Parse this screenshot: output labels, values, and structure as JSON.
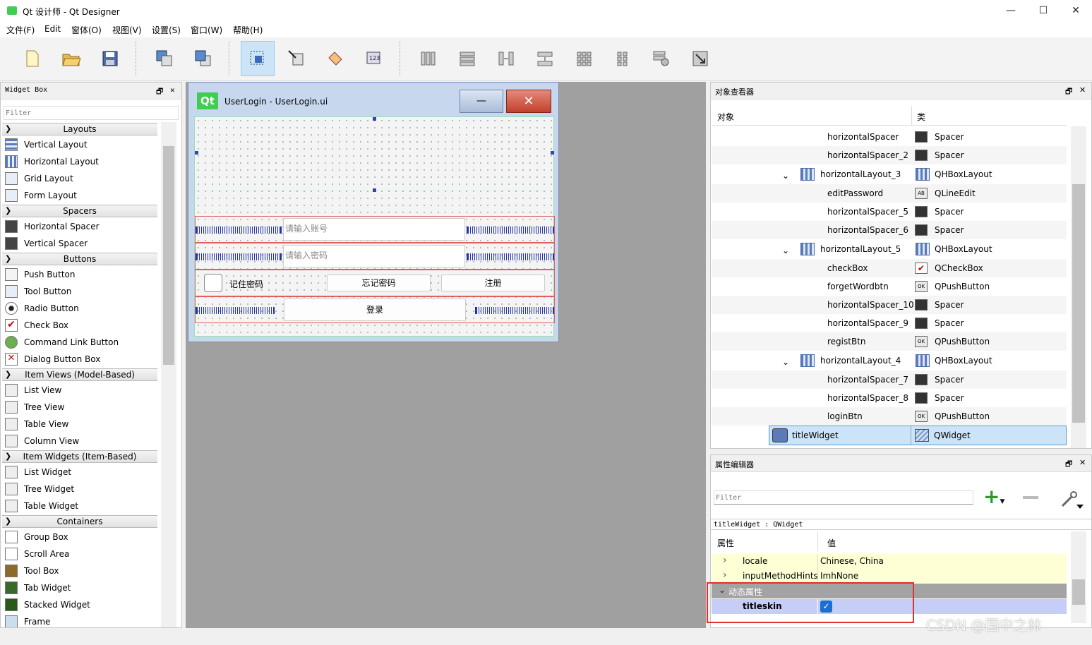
{
  "window": {
    "title": "Qt 设计师 - Qt Designer",
    "min": "—",
    "max": "☐",
    "close": "✕"
  },
  "menubar": [
    "文件(F)",
    "Edit",
    "窗体(O)",
    "视图(V)",
    "设置(S)",
    "窗口(W)",
    "帮助(H)"
  ],
  "toolbar": {
    "icons": [
      "new-file-icon",
      "open-folder-icon",
      "save-icon",
      "send-backward-icon",
      "bring-forward-icon",
      "edit-widgets-icon",
      "edit-signals-slots-icon",
      "edit-buddies-icon",
      "edit-tab-order-icon",
      "layout-horizontal-icon",
      "layout-vertical-icon",
      "layout-h-splitter-icon",
      "layout-v-splitter-icon",
      "layout-grid-icon",
      "layout-form-icon",
      "break-layout-icon",
      "adjust-size-icon"
    ]
  },
  "widget_box": {
    "title": "Widget Box",
    "float": "🗗",
    "close": "✕",
    "filter_placeholder": "Filter",
    "layouts": "Layouts",
    "vertical_layout": "Vertical Layout",
    "horizontal_layout": "Horizontal Layout",
    "grid_layout": "Grid Layout",
    "form_layout": "Form Layout",
    "spacers": "Spacers",
    "horizontal_spacer": "Horizontal Spacer",
    "vertical_spacer": "Vertical Spacer",
    "buttons": "Buttons",
    "push_button": "Push Button",
    "tool_button": "Tool Button",
    "radio_button": "Radio Button",
    "check_box": "Check Box",
    "command_link_button": "Command Link Button",
    "dialog_button_box": "Dialog Button Box",
    "item_views": "Item Views (Model-Based)",
    "list_view": "List View",
    "tree_view": "Tree View",
    "table_view": "Table View",
    "column_view": "Column View",
    "item_widgets": "Item Widgets (Item-Based)",
    "list_widget": "List Widget",
    "tree_widget": "Tree Widget",
    "table_widget": "Table Widget",
    "containers": "Containers",
    "group_box": "Group Box",
    "scroll_area": "Scroll Area",
    "tool_box": "Tool Box",
    "tab_widget": "Tab Widget",
    "stacked_widget": "Stacked Widget",
    "frame": "Frame"
  },
  "form": {
    "logo": "Qt",
    "title": "UserLogin - UserLogin.ui",
    "min": "—",
    "close": "✕",
    "account_placeholder": "请输入账号",
    "password_placeholder": "请输入密码",
    "remember": "记住密码",
    "forget": "忘记密码",
    "register": "注册",
    "login": "登录"
  },
  "object_inspector": {
    "title": "对象查看器",
    "float": "🗗",
    "close": "✕",
    "col_object": "对象",
    "col_class": "类",
    "rows": [
      {
        "name": "horizontalSpacer",
        "cls": "Spacer"
      },
      {
        "name": "horizontalSpacer_2",
        "cls": "Spacer"
      },
      {
        "name": "horizontalLayout_3",
        "cls": "QHBoxLayout"
      },
      {
        "name": "editPassword",
        "cls": "QLineEdit"
      },
      {
        "name": "horizontalSpacer_5",
        "cls": "Spacer"
      },
      {
        "name": "horizontalSpacer_6",
        "cls": "Spacer"
      },
      {
        "name": "horizontalLayout_5",
        "cls": "QHBoxLayout"
      },
      {
        "name": "checkBox",
        "cls": "QCheckBox"
      },
      {
        "name": "forgetWordbtn",
        "cls": "QPushButton"
      },
      {
        "name": "horizontalSpacer_10",
        "cls": "Spacer"
      },
      {
        "name": "horizontalSpacer_9",
        "cls": "Spacer"
      },
      {
        "name": "registBtn",
        "cls": "QPushButton"
      },
      {
        "name": "horizontalLayout_4",
        "cls": "QHBoxLayout"
      },
      {
        "name": "horizontalSpacer_7",
        "cls": "Spacer"
      },
      {
        "name": "horizontalSpacer_8",
        "cls": "Spacer"
      },
      {
        "name": "loginBtn",
        "cls": "QPushButton"
      },
      {
        "name": "titleWidget",
        "cls": "QWidget"
      }
    ]
  },
  "property_editor": {
    "title": "属性编辑器",
    "float": "🗗",
    "close": "✕",
    "filter_placeholder": "Filter",
    "context": "titleWidget : QWidget",
    "col_property": "属性",
    "col_value": "值",
    "locale_name": "locale",
    "locale_value": "Chinese, China",
    "imh_name": "inputMethodHints",
    "imh_value": "ImhNone",
    "dynamic": "动态属性",
    "titleskin_name": "titleskin",
    "titleskin_checked": true,
    "watermark": "CSDN @国中之林"
  }
}
